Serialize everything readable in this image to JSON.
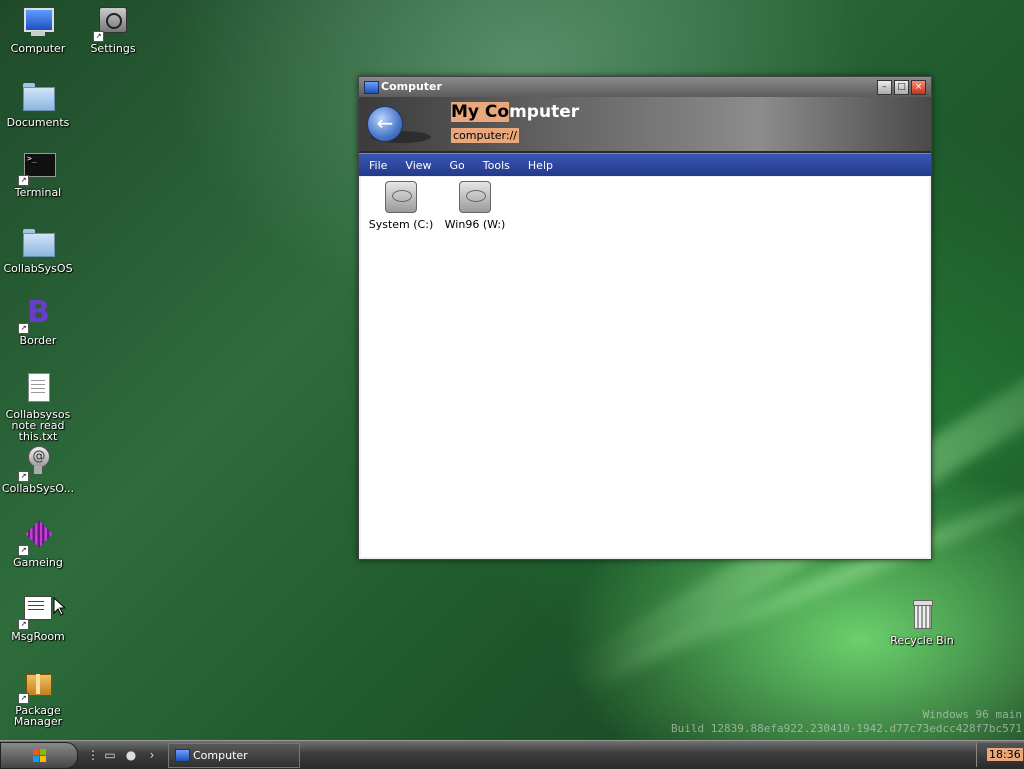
{
  "desktop_icons": [
    {
      "name": "computer",
      "label": "Computer"
    },
    {
      "name": "settings",
      "label": "Settings"
    },
    {
      "name": "documents",
      "label": "Documents"
    },
    {
      "name": "terminal",
      "label": "Terminal"
    },
    {
      "name": "collabsysos-folder",
      "label": "CollabSysOS"
    },
    {
      "name": "border",
      "label": "Border"
    },
    {
      "name": "note",
      "label": "Collabsysos note read this.txt"
    },
    {
      "name": "collabsyso-app",
      "label": "CollabSysO..."
    },
    {
      "name": "gameing",
      "label": "Gameing"
    },
    {
      "name": "msgroom",
      "label": "MsgRoom"
    },
    {
      "name": "package-manager",
      "label": "Package Manager"
    },
    {
      "name": "recycle-bin",
      "label": "Recycle Bin"
    }
  ],
  "window": {
    "title": "Computer",
    "header_title_highlight": "My Co",
    "header_title_rest": "mputer",
    "path": "computer://",
    "menu": [
      "File",
      "View",
      "Go",
      "Tools",
      "Help"
    ],
    "drives": [
      {
        "label": "System (C:)"
      },
      {
        "label": "Win96 (W:)"
      }
    ]
  },
  "watermark": {
    "line1": "Windows 96 main",
    "line2": "Build 12839.88efa922.230410-1942.d77c73edcc428f7bc571"
  },
  "taskbar": {
    "task_label": "Computer",
    "clock": "18:36"
  }
}
